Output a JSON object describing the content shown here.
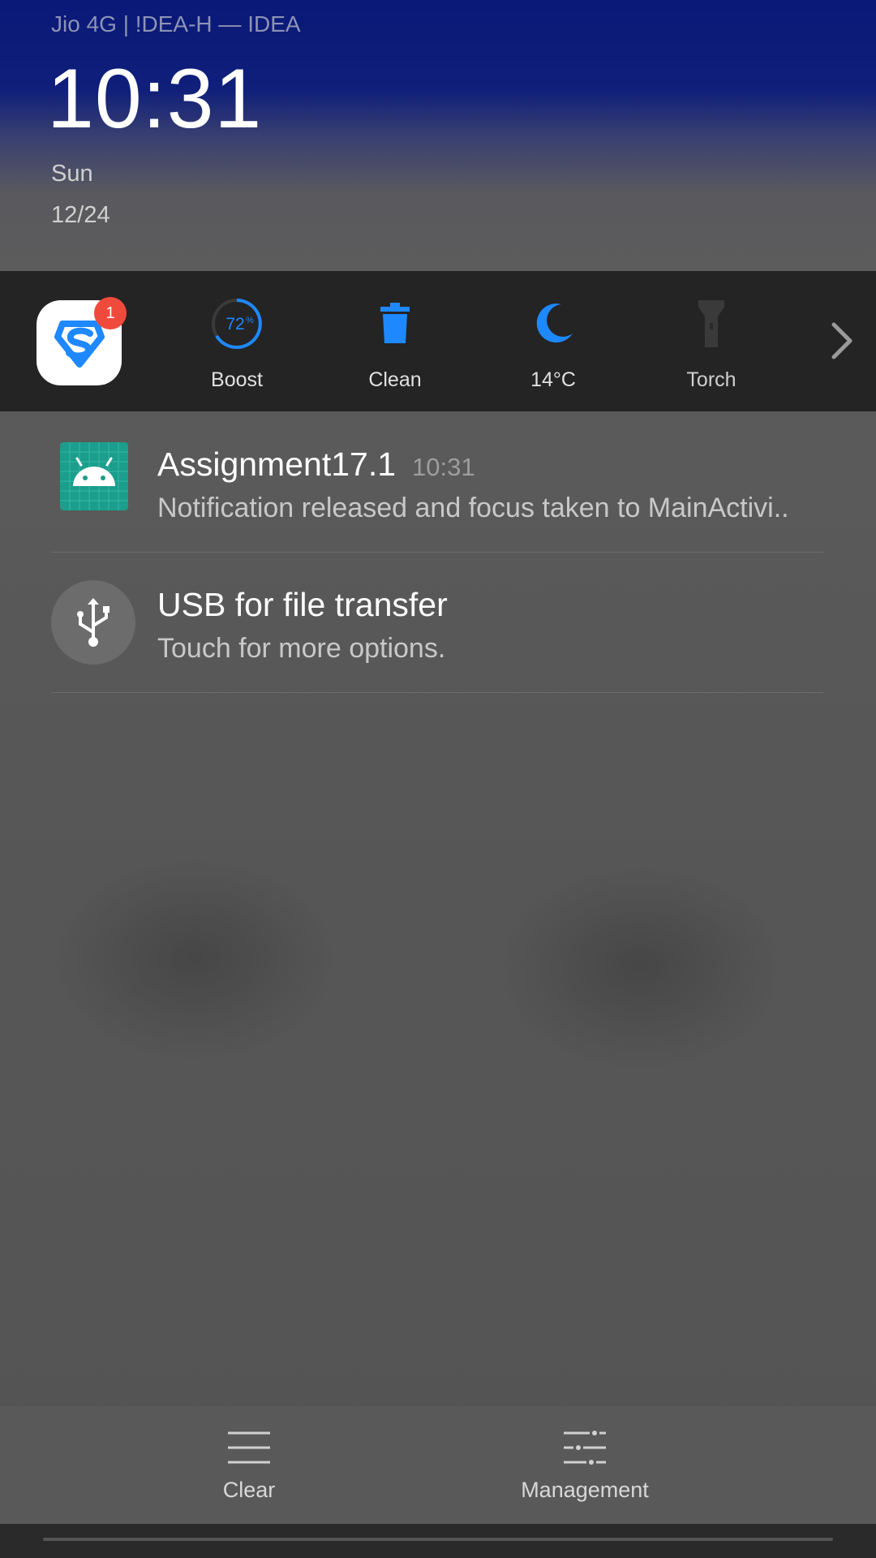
{
  "status": {
    "carrier": "Jio 4G | !DEA-H — IDEA",
    "time": "10:31",
    "day": "Sun",
    "date": "12/24"
  },
  "toggles": {
    "security_badge": "1",
    "boost_percent": "72",
    "boost_percent_unit": "%",
    "boost_label": "Boost",
    "clean_label": "Clean",
    "weather_label": "14°C",
    "torch_label": "Torch"
  },
  "notifications": [
    {
      "title": "Assignment17.1",
      "time": "10:31",
      "text": "Notification released and focus taken to MainActivi.."
    },
    {
      "title": "USB for file transfer",
      "text": "Touch for more options."
    }
  ],
  "bottom": {
    "clear_label": "Clear",
    "management_label": "Management"
  },
  "colors": {
    "accent_blue": "#1e88ff",
    "badge_red": "#f04a3c",
    "android_teal": "#1b9e8c"
  }
}
